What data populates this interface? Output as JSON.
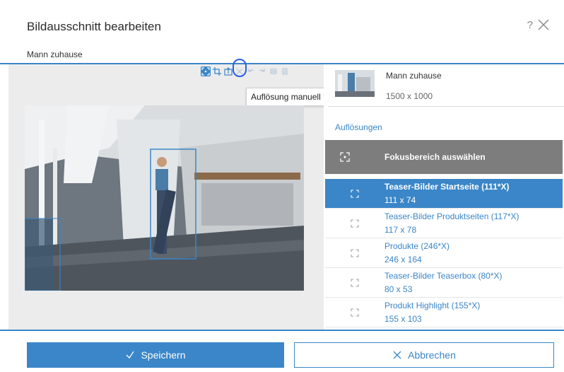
{
  "dialog": {
    "title": "Bildausschnitt bearbeiten",
    "help_label": "?",
    "image_name": "Mann zuhause"
  },
  "toolbar": {
    "buttons": [
      {
        "icon": "focus-icon",
        "active": true
      },
      {
        "icon": "crop-icon",
        "active": false
      },
      {
        "icon": "upload-resolution-icon",
        "active": false
      },
      {
        "icon": "delete-icon",
        "active": false
      },
      {
        "icon": "undo-icon",
        "active": false
      },
      {
        "icon": "redo-icon",
        "active": false
      },
      {
        "icon": "flip-vertical-icon",
        "active": false
      },
      {
        "icon": "flip-horizontal-icon",
        "active": false
      }
    ],
    "tooltip": "Auflösung manuell hochladen"
  },
  "image_info": {
    "name": "Mann zuhause",
    "dimensions": "1500 x 1000"
  },
  "resolutions": {
    "heading": "Auflösungen",
    "focus_button": "Fokusbereich auswählen",
    "items": [
      {
        "title": "Teaser-Bilder Startseite (111*X)",
        "size": "111 x 74",
        "selected": true
      },
      {
        "title": "Teaser-Bilder Produktseiten (117*X)",
        "size": "117 x 78",
        "selected": false
      },
      {
        "title": "Produkte (246*X)",
        "size": "246 x 164",
        "selected": false
      },
      {
        "title": "Teaser-Bilder Teaserbox (80*X)",
        "size": "80 x 53",
        "selected": false
      },
      {
        "title": "Produkt Highlight (155*X)",
        "size": "155 x 103",
        "selected": false
      }
    ]
  },
  "footer": {
    "save_label": "Speichern",
    "cancel_label": "Abbrechen"
  },
  "colors": {
    "accent": "#3a86c8",
    "focus_button_bg": "#7d7d7d",
    "highlight_ring": "#2c5ee8"
  }
}
